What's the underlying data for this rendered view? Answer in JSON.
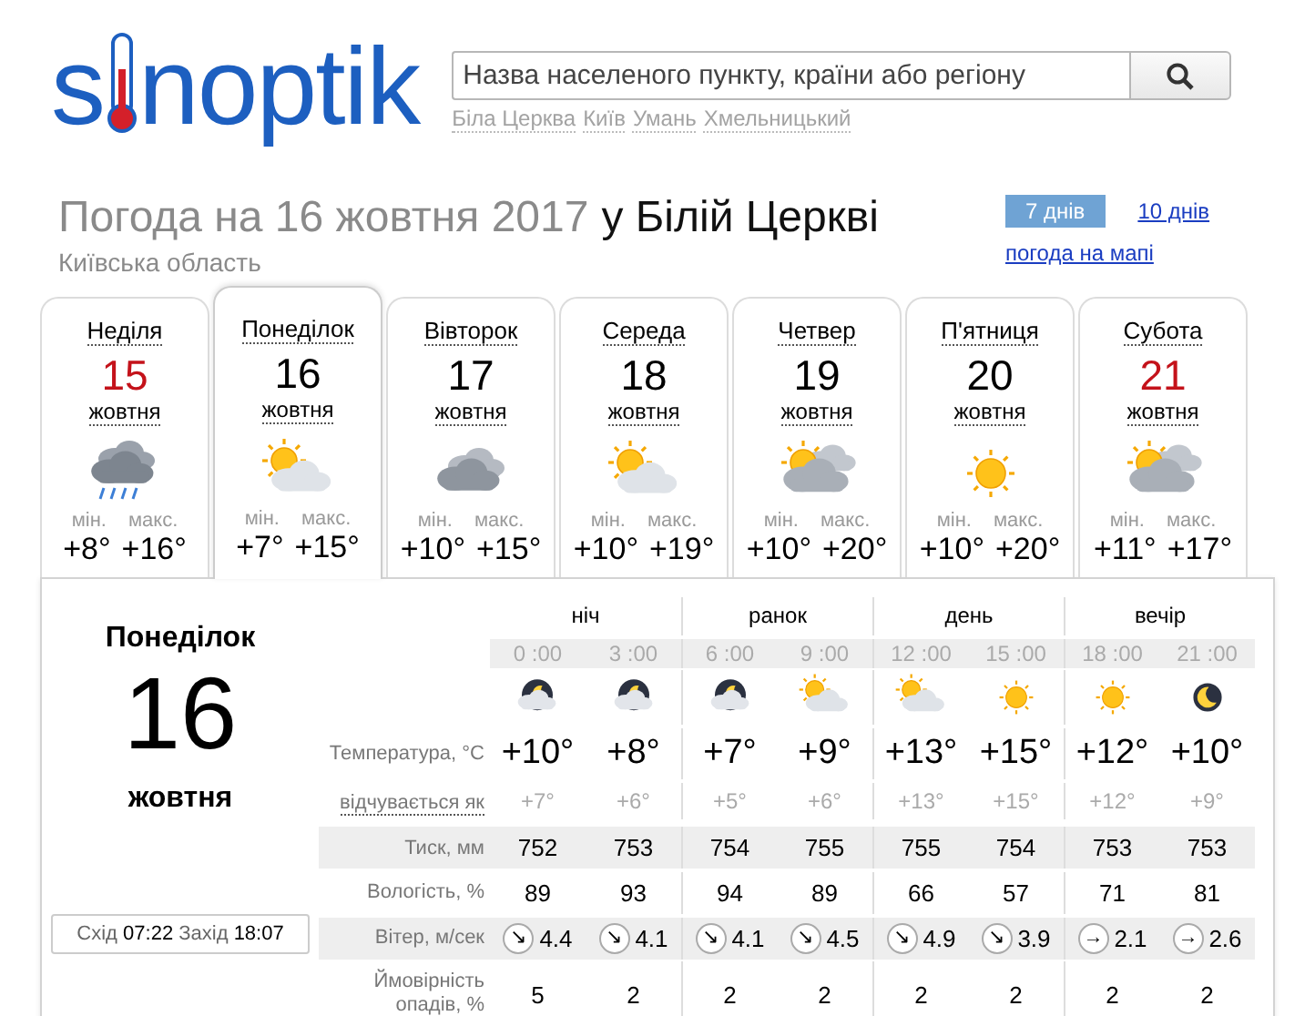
{
  "logo": {
    "parts": [
      "s",
      "noptik"
    ]
  },
  "search": {
    "placeholder": "Назва населеного пункту, країни або регіону"
  },
  "recent_cities": [
    "Біла Церква",
    "Київ",
    "Умань",
    "Хмельницький"
  ],
  "title": {
    "prefix": "Погода на 16 жовтня 2017",
    "place": "у Білій Церкві"
  },
  "region": "Київська область",
  "range_tabs": [
    {
      "label": "7 днів",
      "selected": true
    },
    {
      "label": "10 днів",
      "selected": false
    }
  ],
  "map_link": "погода на мапі",
  "days": [
    {
      "weekday": "Неділя",
      "date": "15",
      "month": "жовтня",
      "kind": "rain",
      "min_label": "мін.",
      "min": "+8°",
      "max_label": "макс.",
      "max": "+16°",
      "weekend": true,
      "selected": false
    },
    {
      "weekday": "Понеділок",
      "date": "16",
      "month": "жовтня",
      "kind": "sun-cloud",
      "min_label": "мін.",
      "min": "+7°",
      "max_label": "макс.",
      "max": "+15°",
      "weekend": false,
      "selected": true
    },
    {
      "weekday": "Вівторок",
      "date": "17",
      "month": "жовтня",
      "kind": "cloudy",
      "min_label": "мін.",
      "min": "+10°",
      "max_label": "макс.",
      "max": "+15°",
      "weekend": false,
      "selected": false
    },
    {
      "weekday": "Середа",
      "date": "18",
      "month": "жовтня",
      "kind": "sun-cloud",
      "min_label": "мін.",
      "min": "+10°",
      "max_label": "макс.",
      "max": "+19°",
      "weekend": false,
      "selected": false
    },
    {
      "weekday": "Четвер",
      "date": "19",
      "month": "жовтня",
      "kind": "sun-clouds",
      "min_label": "мін.",
      "min": "+10°",
      "max_label": "макс.",
      "max": "+20°",
      "weekend": false,
      "selected": false
    },
    {
      "weekday": "П'ятниця",
      "date": "20",
      "month": "жовтня",
      "kind": "sun",
      "min_label": "мін.",
      "min": "+10°",
      "max_label": "макс.",
      "max": "+20°",
      "weekend": false,
      "selected": false
    },
    {
      "weekday": "Субота",
      "date": "21",
      "month": "жовтня",
      "kind": "sun-clouds",
      "min_label": "мін.",
      "min": "+11°",
      "max_label": "макс.",
      "max": "+17°",
      "weekend": true,
      "selected": false
    }
  ],
  "detail": {
    "weekday": "Понеділок",
    "date": "16",
    "month": "жовтня",
    "sun": {
      "rise_label": "Схід",
      "rise": "07:22",
      "set_label": "Захід",
      "set": "18:07"
    },
    "periods": [
      "ніч",
      "ранок",
      "день",
      "вечір"
    ],
    "times": [
      "0 :00",
      "3 :00",
      "6 :00",
      "9 :00",
      "12 :00",
      "15 :00",
      "18 :00",
      "21 :00"
    ],
    "icons": [
      {
        "kind": "night-cloud"
      },
      {
        "kind": "night-cloud"
      },
      {
        "kind": "night-cloud"
      },
      {
        "kind": "sun-cloud"
      },
      {
        "kind": "sun-cloud"
      },
      {
        "kind": "sun"
      },
      {
        "kind": "sun"
      },
      {
        "kind": "moon"
      }
    ],
    "rows": [
      {
        "kind": "temp",
        "label": "Температура, °C",
        "shaded": false,
        "values": [
          "+10°",
          "+8°",
          "+7°",
          "+9°",
          "+13°",
          "+15°",
          "+12°",
          "+10°"
        ]
      },
      {
        "kind": "feels",
        "label": "відчувається як",
        "shaded": false,
        "values": [
          "+7°",
          "+6°",
          "+5°",
          "+6°",
          "+13°",
          "+15°",
          "+12°",
          "+9°"
        ]
      },
      {
        "kind": "value",
        "label": "Тиск, мм",
        "shaded": true,
        "values": [
          "752",
          "753",
          "754",
          "755",
          "755",
          "754",
          "753",
          "753"
        ]
      },
      {
        "kind": "value",
        "label": "Вологість, %",
        "shaded": false,
        "values": [
          "89",
          "93",
          "94",
          "89",
          "66",
          "57",
          "71",
          "81"
        ]
      },
      {
        "kind": "wind",
        "label": "Вітер, м/сек",
        "shaded": true,
        "values": [
          "4.4",
          "4.1",
          "4.1",
          "4.5",
          "4.9",
          "3.9",
          "2.1",
          "2.6"
        ],
        "arrows": [
          "↘",
          "↘",
          "↘",
          "↘",
          "↘",
          "↘",
          "→",
          "→"
        ]
      },
      {
        "kind": "value",
        "label": "Ймовірність опадів, %",
        "shaded": false,
        "values": [
          "5",
          "2",
          "2",
          "2",
          "2",
          "2",
          "2",
          "2"
        ]
      }
    ]
  }
}
